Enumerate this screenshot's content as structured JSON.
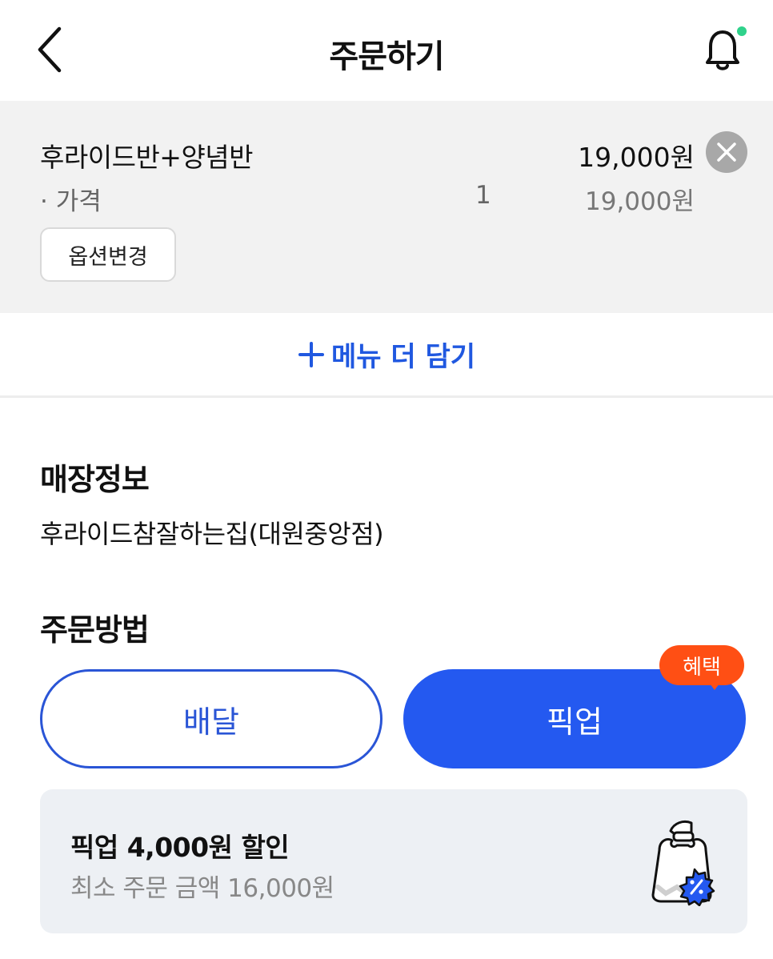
{
  "header": {
    "title": "주문하기",
    "back_icon": "chevron-left-icon",
    "bell_icon": "bell-icon",
    "notification_dot_color": "#2fd28b"
  },
  "cart": {
    "item_name": "후라이드반+양념반",
    "item_price": "19,000원",
    "remove_icon": "close-icon",
    "option_label": "· 가격",
    "option_qty": "1",
    "option_price": "19,000원",
    "option_change_label": "옵션변경"
  },
  "add_more": {
    "label": "메뉴 더 담기",
    "icon": "plus-icon"
  },
  "store": {
    "section_title": "매장정보",
    "name": "후라이드참잘하는집(대원중앙점)"
  },
  "order_method": {
    "section_title": "주문방법",
    "delivery_label": "배달",
    "pickup_label": "픽업",
    "benefit_badge": "혜택",
    "selected": "픽업"
  },
  "promo": {
    "title": "픽업 4,000원 할인",
    "subtitle": "최소 주문 금액 16,000원",
    "icon": "shopping-bag-discount-icon"
  },
  "colors": {
    "accent": "#2459f0",
    "badge": "#ff4f14"
  }
}
